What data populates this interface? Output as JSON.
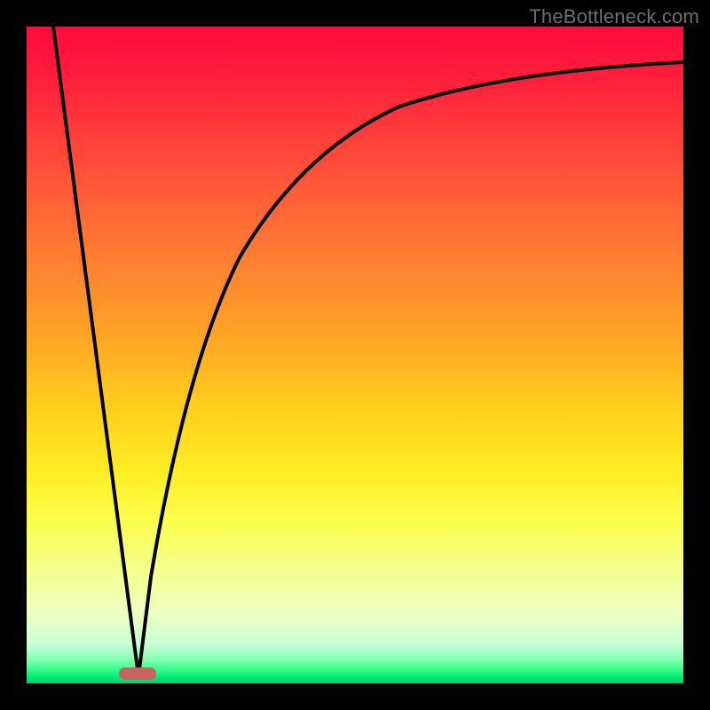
{
  "watermark": "TheBottleneck.com",
  "colors": {
    "frame": "#000000",
    "top": "#ff0a3c",
    "bottom": "#00d068",
    "marker": "#c96262",
    "curve": "#000000"
  },
  "chart_data": {
    "type": "line",
    "title": "",
    "xlabel": "",
    "ylabel": "",
    "xlim": [
      0,
      100
    ],
    "ylim": [
      0,
      100
    ],
    "grid": false,
    "legend": null,
    "marker": {
      "x": 17,
      "y": 1
    },
    "series": [
      {
        "name": "left-line",
        "x": [
          4,
          17
        ],
        "y": [
          100,
          1
        ]
      },
      {
        "name": "right-curve",
        "x": [
          17,
          20,
          24,
          28,
          34,
          40,
          48,
          56,
          64,
          74,
          84,
          92,
          100
        ],
        "y": [
          1,
          18,
          36,
          50,
          62,
          70,
          78,
          83,
          86,
          89,
          91,
          92.5,
          93.5
        ]
      }
    ]
  }
}
